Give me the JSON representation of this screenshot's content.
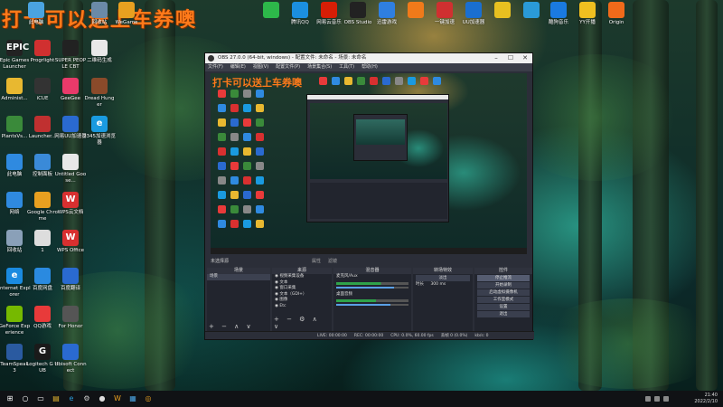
{
  "overlay_title": "打卡可以送上车券噢",
  "desktop": {
    "top_row": [
      {
        "label": "此电脑",
        "icon": "computer-icon",
        "color": "#4aa3e0"
      },
      {
        "label": "回收站",
        "icon": "recycle-bin-icon",
        "color": "#6b8aa8"
      },
      {
        "label": "WeGame",
        "icon": "wegame-icon",
        "color": "#e8a020"
      },
      {
        "label": "",
        "icon": "wechat-icon",
        "color": "#2db84a"
      },
      {
        "label": "腾讯QQ",
        "icon": "qq-icon",
        "color": "#1b8fe0"
      },
      {
        "label": "网易云音乐",
        "icon": "netease-music-icon",
        "color": "#d81e06"
      },
      {
        "label": "OBS Studio",
        "icon": "obs-icon",
        "color": "#222222"
      },
      {
        "label": "迅雷游戏",
        "icon": "xunlei-icon",
        "color": "#2f7fe0"
      },
      {
        "label": "",
        "icon": "orange-app-icon",
        "color": "#f07a1a"
      },
      {
        "label": "一键加速",
        "icon": "accelerator-icon",
        "color": "#d03030"
      },
      {
        "label": "UU加速器",
        "icon": "uu-icon",
        "color": "#1a6fd0"
      },
      {
        "label": "",
        "icon": "yellow-app-icon",
        "color": "#e8c020"
      },
      {
        "label": "",
        "icon": "blue-app-icon",
        "color": "#2a9ad8"
      },
      {
        "label": "酷狗音乐",
        "icon": "kugou-icon",
        "color": "#1a7ae0"
      },
      {
        "label": "YY开播",
        "icon": "yy-icon",
        "color": "#f0c020"
      },
      {
        "label": "Origin",
        "icon": "origin-icon",
        "color": "#f06a1a"
      }
    ],
    "col1": [
      {
        "label": "Epic Games Launcher",
        "icon": "epic-icon",
        "color": "#222222",
        "text": "EPIC"
      },
      {
        "label": "Administ...",
        "icon": "folder-icon",
        "color": "#e8b830",
        "text": ""
      },
      {
        "label": "PlantsVs...",
        "icon": "plants-icon",
        "color": "#3a8a3a",
        "text": ""
      },
      {
        "label": "此电脑",
        "icon": "computer-icon",
        "color": "#2f8ae0",
        "text": ""
      },
      {
        "label": "网络",
        "icon": "network-icon",
        "color": "#2f8ae0",
        "text": ""
      },
      {
        "label": "回收站",
        "icon": "recycle-bin-icon",
        "color": "#8aa0b8",
        "text": ""
      },
      {
        "label": "Internet Explorer",
        "icon": "ie-icon",
        "color": "#1a8ae0",
        "text": "e"
      },
      {
        "label": "GeForce Experience",
        "icon": "geforce-icon",
        "color": "#76b900",
        "text": ""
      },
      {
        "label": "TeamSpeak 3",
        "icon": "teamspeak-icon",
        "color": "#2a5aa0",
        "text": ""
      }
    ],
    "col2": [
      {
        "label": "Progrlight",
        "icon": "progrlight-icon",
        "color": "#d03030",
        "text": ""
      },
      {
        "label": "iCUE",
        "icon": "icue-icon",
        "color": "#333333",
        "text": ""
      },
      {
        "label": "Launcher...",
        "icon": "launcher-icon",
        "color": "#c03030",
        "text": ""
      },
      {
        "label": "控制面板",
        "icon": "control-panel-icon",
        "color": "#3a8ad8",
        "text": ""
      },
      {
        "label": "Google Chrome",
        "icon": "chrome-icon",
        "color": "#e8a020",
        "text": ""
      },
      {
        "label": "1",
        "icon": "file-icon",
        "color": "#dddddd",
        "text": ""
      },
      {
        "label": "百度网盘",
        "icon": "baidu-pan-icon",
        "color": "#2a8ae0",
        "text": ""
      },
      {
        "label": "QQ游戏",
        "icon": "qq-game-icon",
        "color": "#e83a3a",
        "text": ""
      },
      {
        "label": "Logitech G HUB",
        "icon": "logitech-icon",
        "color": "#1a1a1a",
        "text": "G"
      }
    ],
    "col3": [
      {
        "label": "SUPER PEOPLE CBT",
        "icon": "super-people-icon",
        "color": "#222222",
        "text": ""
      },
      {
        "label": "GeeGee",
        "icon": "geegee-icon",
        "color": "#e83a6a",
        "text": ""
      },
      {
        "label": "网易UU加速器",
        "icon": "uu-accel-icon",
        "color": "#2a6ad0",
        "text": ""
      },
      {
        "label": "Untitled Goose...",
        "icon": "goose-icon",
        "color": "#e8e8e8",
        "text": ""
      },
      {
        "label": "WPS云文档",
        "icon": "wps-cloud-icon",
        "color": "#d83030",
        "text": "W"
      },
      {
        "label": "WPS Office",
        "icon": "wps-office-icon",
        "color": "#d83030",
        "text": "W"
      },
      {
        "label": "百度翻译",
        "icon": "baidu-translate-icon",
        "color": "#2a6ad0",
        "text": ""
      },
      {
        "label": "For Honor",
        "icon": "for-honor-icon",
        "color": "#555555",
        "text": ""
      },
      {
        "label": "Ubisoft Connect",
        "icon": "ubisoft-icon",
        "color": "#2a6ad0",
        "text": ""
      }
    ],
    "col4": [
      {
        "label": "二维码生成",
        "icon": "qr-icon",
        "color": "#e8e8e8",
        "text": ""
      },
      {
        "label": "Dread Hunger",
        "icon": "dread-hunger-icon",
        "color": "#8a4a2a",
        "text": ""
      },
      {
        "label": "2345加速浏览器",
        "icon": "browser-2345-icon",
        "color": "#1a9ae0",
        "text": "e"
      }
    ]
  },
  "obs": {
    "title": "OBS 27.0.0 (64-bit, windows) - 配置文件: 未命名 - 场景: 未命名",
    "menu": [
      "文件(F)",
      "编辑(E)",
      "视图(V)",
      "配置文件(P)",
      "场景集合(S)",
      "工具(T)",
      "帮助(H)"
    ],
    "no_source": "未选择源",
    "source_tabs": [
      "属性",
      "滤镜"
    ],
    "docks": {
      "scenes": {
        "title": "场景",
        "items": [
          "场景"
        ]
      },
      "sources": {
        "title": "来源",
        "items": [
          "视频采集设备",
          "文本",
          "窗口采集",
          "文本（GDI+）",
          "图像",
          "Etc"
        ]
      },
      "mixer": {
        "title": "混音器",
        "channels": [
          {
            "name": "麦克风/Aux",
            "level": 0.62,
            "volume": 0.8
          },
          {
            "name": "桌面音频",
            "level": 0.55,
            "volume": 0.75
          }
        ]
      },
      "transitions": {
        "title": "转场特效",
        "type": "淡出",
        "duration_label": "时长",
        "duration": "300 ms"
      },
      "controls": {
        "title": "控件",
        "buttons": [
          "停止推流",
          "开始录制",
          "启动虚拟摄像机",
          "工作室模式",
          "设置",
          "退出"
        ]
      }
    },
    "status": {
      "drop": "丢帧 0 (0.0%)",
      "live": "LIVE: 00:00:00",
      "rec": "REC: 00:00:00",
      "cpu": "CPU: 0.0%, 60.00 fps",
      "net": "kb/s: 0"
    }
  },
  "taskbar": {
    "time": "21:40",
    "date": "2022/2/10",
    "apps": [
      "windows-start-icon",
      "search-icon",
      "task-view-icon",
      "file-explorer-icon",
      "edge-icon",
      "settings-icon",
      "obs-icon",
      "wegame-icon",
      "store-icon",
      "chrome-icon"
    ]
  }
}
